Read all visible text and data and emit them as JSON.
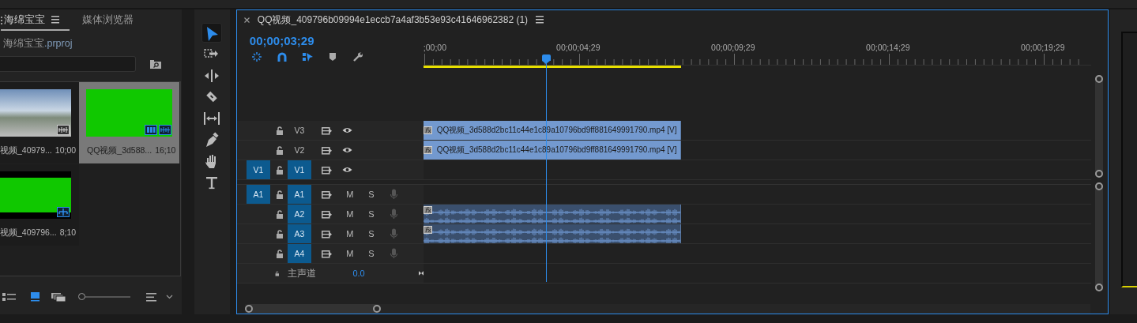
{
  "project_panel": {
    "tabs": [
      {
        "label": "海绵宝宝",
        "selected": true
      },
      {
        "label": "媒体浏览器",
        "selected": false
      }
    ],
    "project_file": {
      "name": "海绵宝宝",
      "extension": ".prproj"
    },
    "items": [
      {
        "name": "视频_40979...",
        "duration": "10;00",
        "thumbnail": {
          "kind": "photo"
        },
        "selected": false,
        "badges": [
          {
            "kind": "waveform"
          }
        ]
      },
      {
        "name": "QQ视频_3d588...",
        "duration": "16;10",
        "thumbnail": {
          "kind": "greenscreen"
        },
        "selected": true,
        "badges": [
          {
            "kind": "video"
          },
          {
            "kind": "audio"
          }
        ]
      },
      {
        "name": "视频_409796...",
        "duration": "8;10",
        "thumbnail": {
          "kind": "letterbox"
        },
        "selected": false,
        "badges": [
          {
            "kind": "sequence"
          }
        ]
      }
    ],
    "icon_size": {
      "level": 0
    }
  },
  "tools": [
    {
      "kind": "selection",
      "selected": true
    },
    {
      "kind": "track-select",
      "selected": false
    },
    {
      "kind": "ripple-edit",
      "selected": false
    },
    {
      "kind": "razor",
      "selected": false
    },
    {
      "kind": "slip",
      "selected": false
    },
    {
      "kind": "pen",
      "selected": false
    },
    {
      "kind": "hand",
      "selected": false
    },
    {
      "kind": "type",
      "selected": false
    }
  ],
  "timeline": {
    "title": "QQ视频_409796b09994e1eccb7a4af3b53e93c41646962382 (1)",
    "timecode": "00;00;03;29",
    "toggles": [
      {
        "kind": "nest",
        "on": true
      },
      {
        "kind": "snap",
        "on": true
      },
      {
        "kind": "linked-selection",
        "on": true
      },
      {
        "kind": "marker",
        "on": false
      },
      {
        "kind": "settings",
        "on": false
      }
    ],
    "ruler_labels": [
      ";00;00",
      "00;00;04;29",
      "00;00;09;29",
      "00;00;14;29",
      "00;00;19;29"
    ],
    "work_area": {
      "level": 0.386
    },
    "video_tracks": [
      {
        "name": "V3",
        "targeted": false,
        "clips": [
          {
            "label": "QQ视频_3d588d2bc11c44e1c89a10796bd9ff881649991790.mp4 [V]",
            "level": 0.386
          }
        ]
      },
      {
        "name": "V2",
        "targeted": false,
        "clips": [
          {
            "label": "QQ视频_3d588d2bc11c44e1c89a10796bd9ff881649991790.mp4 [V]",
            "level": 0.386
          }
        ]
      },
      {
        "name": "V1",
        "source": "V1",
        "targeted": true
      }
    ],
    "audio_tracks": [
      {
        "name": "A1",
        "source": "A1",
        "targeted": true,
        "mute": "M",
        "solo": "S"
      },
      {
        "name": "A2",
        "targeted": true,
        "mute": "M",
        "solo": "S",
        "clips": [
          {
            "level": 0.386
          }
        ]
      },
      {
        "name": "A3",
        "targeted": true,
        "mute": "M",
        "solo": "S",
        "clips": [
          {
            "level": 0.386
          }
        ]
      },
      {
        "name": "A4",
        "targeted": true,
        "mute": "M",
        "solo": "S"
      }
    ],
    "master": {
      "label": "主声道",
      "value": "0.0"
    }
  }
}
